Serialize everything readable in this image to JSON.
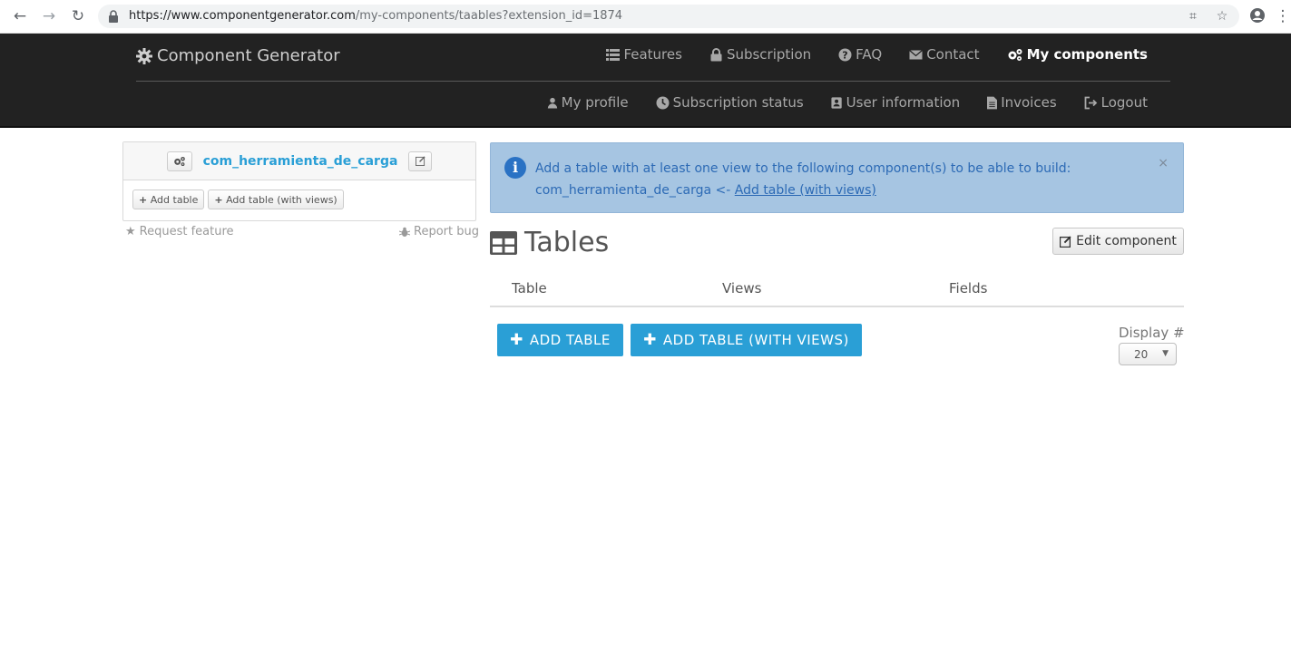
{
  "browser": {
    "url_host": "https://www.componentgenerator.com",
    "url_path": "/my-components/taables?extension_id=1874"
  },
  "navbar": {
    "brand": "Component Generator",
    "top_items": [
      {
        "label": "Features",
        "icon": "list-icon"
      },
      {
        "label": "Subscription",
        "icon": "lock-icon"
      },
      {
        "label": "FAQ",
        "icon": "question-icon"
      },
      {
        "label": "Contact",
        "icon": "envelope-icon"
      },
      {
        "label": "My components",
        "icon": "cogs-icon",
        "active": true
      }
    ],
    "bottom_items": [
      {
        "label": "My profile",
        "icon": "user-icon"
      },
      {
        "label": "Subscription status",
        "icon": "clock-icon"
      },
      {
        "label": "User information",
        "icon": "id-card-icon"
      },
      {
        "label": "Invoices",
        "icon": "file-icon"
      },
      {
        "label": "Logout",
        "icon": "sign-out-icon"
      }
    ]
  },
  "component_panel": {
    "name": "com_herramienta_de_carga",
    "add_table": "Add table",
    "add_table_views": "Add table (with views)",
    "request_feature": "Request feature",
    "report_bug": "Report bug"
  },
  "alert": {
    "message": "Add a table with at least one view to the following component(s) to be able to build:",
    "component": "com_herramienta_de_carga <-",
    "link": "Add table (with views)",
    "close": "×"
  },
  "main": {
    "title": "Tables",
    "edit_button": "Edit component",
    "columns": [
      "Table",
      "Views",
      "Fields"
    ],
    "add_table_button": "ADD TABLE",
    "add_table_views_button": "ADD TABLE (WITH VIEWS)",
    "display_label": "Display #",
    "display_value": "20"
  },
  "colors": {
    "navbar": "#222222",
    "accent": "#2a9fd6",
    "alert_bg": "#a6c5e2"
  }
}
